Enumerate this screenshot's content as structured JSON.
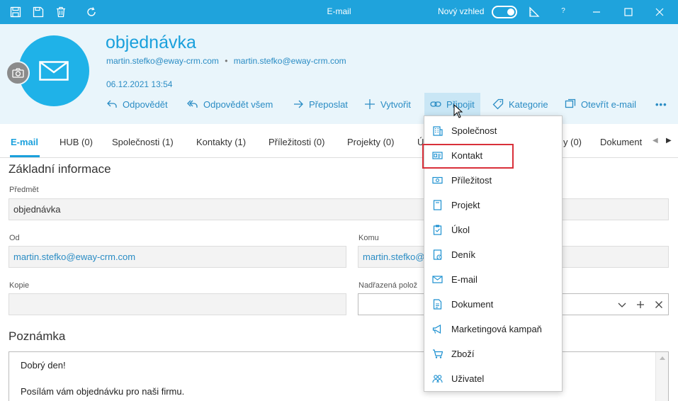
{
  "window": {
    "title": "E-mail",
    "new_look_label": "Nový vzhled",
    "help_label": "?"
  },
  "header": {
    "title": "objednávka",
    "from_email": "martin.stefko@eway-crm.com",
    "separator": "•",
    "to_email": "martin.stefko@eway-crm.com",
    "date": "06.12.2021 13:54"
  },
  "actions": [
    {
      "label": "Odpovědět",
      "icon": "reply-icon"
    },
    {
      "label": "Odpovědět všem",
      "icon": "reply-all-icon"
    },
    {
      "label": "Přeposlat",
      "icon": "forward-icon"
    },
    {
      "label": "Vytvořit",
      "icon": "plus-icon"
    },
    {
      "label": "Připojit",
      "icon": "link-icon"
    },
    {
      "label": "Kategorie",
      "icon": "tag-icon"
    },
    {
      "label": "Otevřít e-mail",
      "icon": "open-email-icon"
    },
    {
      "label": "•••",
      "icon": "more-icon"
    }
  ],
  "tabs": [
    {
      "label": "E-mail",
      "selected": true
    },
    {
      "label": "HUB (0)"
    },
    {
      "label": "Společnosti (1)"
    },
    {
      "label": "Kontakty (1)"
    },
    {
      "label": "Příležitosti (0)"
    },
    {
      "label": "Projekty (0)"
    },
    {
      "label": "Ú"
    },
    {
      "label": "y (0)"
    },
    {
      "label": "Dokument"
    }
  ],
  "basic": {
    "title": "Základní informace",
    "subject_label": "Předmět",
    "subject_value": "objednávka",
    "from_label": "Od",
    "from_value": "martin.stefko@eway-crm.com",
    "to_label": "Komu",
    "to_value": "martin.stefko@",
    "cc_label": "Kopie",
    "cc_value": "",
    "parent_label": "Nadřazená polož",
    "parent_value": ""
  },
  "note": {
    "title": "Poznámka",
    "line1": "Dobrý den!",
    "line2": "Posílám vám objednávku pro naši firmu."
  },
  "dropdown": {
    "items": [
      {
        "label": "Společnost",
        "icon": "company-icon"
      },
      {
        "label": "Kontakt",
        "icon": "contact-card-icon",
        "highlighted": true
      },
      {
        "label": "Příležitost",
        "icon": "opportunity-icon"
      },
      {
        "label": "Projekt",
        "icon": "project-icon"
      },
      {
        "label": "Úkol",
        "icon": "task-icon"
      },
      {
        "label": "Deník",
        "icon": "journal-icon"
      },
      {
        "label": "E-mail",
        "icon": "email-icon"
      },
      {
        "label": "Dokument",
        "icon": "document-icon"
      },
      {
        "label": "Marketingová kampaň",
        "icon": "campaign-icon"
      },
      {
        "label": "Zboží",
        "icon": "goods-icon"
      },
      {
        "label": "Uživatel",
        "icon": "users-icon"
      }
    ]
  },
  "colors": {
    "accent": "#1fa3dc",
    "header_bg": "#e9f5fb",
    "highlight_border": "#d9303a"
  }
}
